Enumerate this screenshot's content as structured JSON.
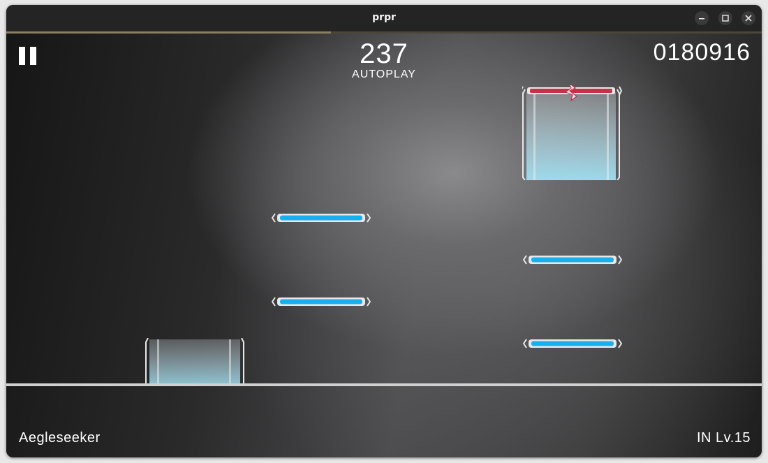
{
  "window": {
    "title": "prpr",
    "controls": [
      "minimize-icon",
      "maximize-icon",
      "close-icon"
    ]
  },
  "hud": {
    "combo": "237",
    "mode": "AUTOPLAY",
    "score": "0180916",
    "song_name": "Aegleseeker",
    "difficulty": "IN Lv.15",
    "pause_icon": "pause-icon",
    "progress_fraction": 0.43
  },
  "colors": {
    "tap_note": "#16b0ee",
    "flick_note": "#c8304a",
    "hold_body": "#9fe0f2",
    "judge_line": "#d0d0d0"
  },
  "notes": {
    "tap": [
      {
        "type": "tap"
      },
      {
        "type": "tap"
      },
      {
        "type": "tap"
      },
      {
        "type": "tap"
      }
    ],
    "hold": [
      {
        "type": "hold"
      },
      {
        "type": "hold-flick-head"
      }
    ]
  }
}
